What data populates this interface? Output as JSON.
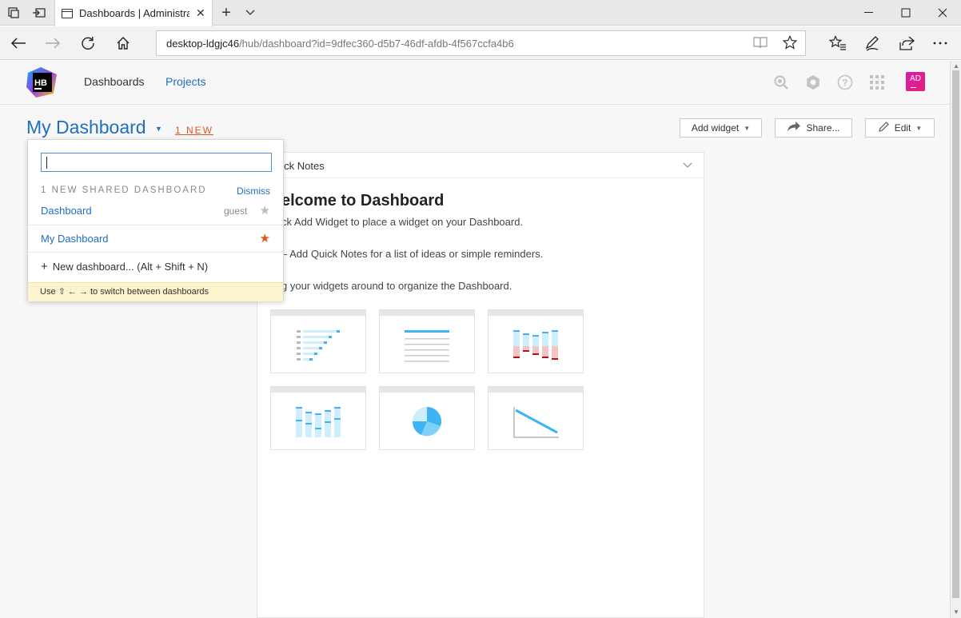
{
  "browser": {
    "tab_title": "Dashboards | Administra",
    "url_host": "desktop-ldgjc46",
    "url_path": "/hub/dashboard?id=9dfec360-d5b7-46df-afdb-4f567ccfa4b6"
  },
  "header": {
    "logo_text": "HB",
    "nav": {
      "dashboards": "Dashboards",
      "projects": "Projects"
    },
    "avatar_initials": "AD"
  },
  "dashboard": {
    "title": "My Dashboard",
    "new_badge": "1 NEW",
    "toolbar": {
      "add_widget": "Add widget",
      "share": "Share...",
      "edit": "Edit"
    }
  },
  "widget": {
    "title": "uick Notes",
    "heading": "elcome to Dashboard",
    "lines": [
      "ck Add Widget to place a widget on your Dashboard.",
      "– Add Quick Notes for a list of ideas or simple reminders.",
      "g your widgets around to organize the Dashboard."
    ]
  },
  "dropdown": {
    "search_value": "",
    "section_label": "1 NEW SHARED DASHBOARD",
    "dismiss": "Dismiss",
    "shared_item": {
      "label": "Dashboard",
      "owner": "guest",
      "favorite": false
    },
    "own_item": {
      "label": "My Dashboard",
      "favorite": true
    },
    "new_dashboard": "New dashboard... (Alt + Shift + N)",
    "hint": "Use ⇧ ← → to switch between dashboards"
  },
  "colors": {
    "link": "#1f6ec2",
    "accent": "#e2541f",
    "star_active": "#e2541f",
    "star_inactive": "#bbbbbb",
    "hint_bg": "#fdf4cd"
  }
}
